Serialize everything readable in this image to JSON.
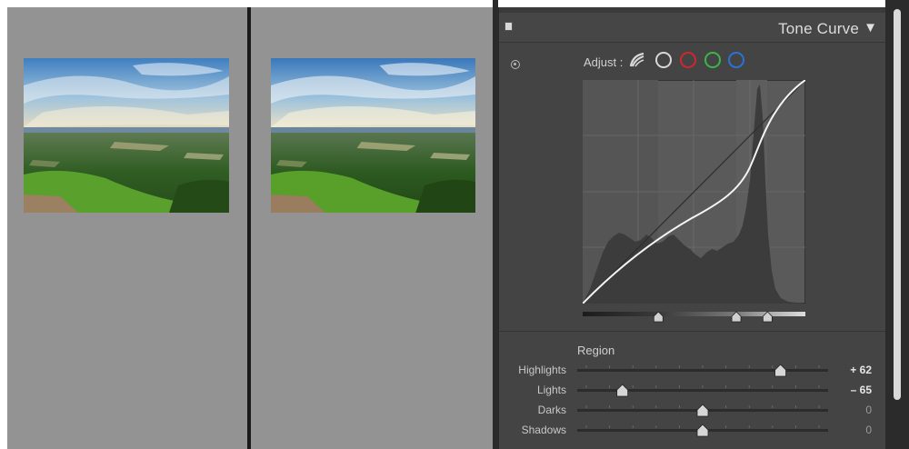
{
  "compare": {
    "before_label": "",
    "after_label": ""
  },
  "panel": {
    "title": "Tone Curve",
    "collapse_glyph": "▼",
    "adjust_label": "Adjust :",
    "channels": [
      "parametric",
      "rgb",
      "red",
      "green",
      "blue"
    ],
    "region_label": "Region",
    "sliders": [
      {
        "name": "Highlights",
        "value": "+ 62",
        "position": 0.81
      },
      {
        "name": "Lights",
        "value": "– 65",
        "position": 0.18
      },
      {
        "name": "Darks",
        "value": "0",
        "position": 0.5
      },
      {
        "name": "Shadows",
        "value": "0",
        "position": 0.5
      }
    ],
    "split_points": [
      0.34,
      0.69,
      0.83
    ]
  },
  "colors": {
    "panel_bg": "#444444",
    "curve_bg": "#5a5a5a",
    "histogram": "#3c3c3c",
    "red_channel": "#d4252d",
    "green_channel": "#3cb548",
    "blue_channel": "#2b72d8"
  },
  "icons": {
    "panel_toggle": "switch-icon",
    "target_adjust": "target-adjust-icon",
    "collapse": "triangle-down-icon"
  }
}
